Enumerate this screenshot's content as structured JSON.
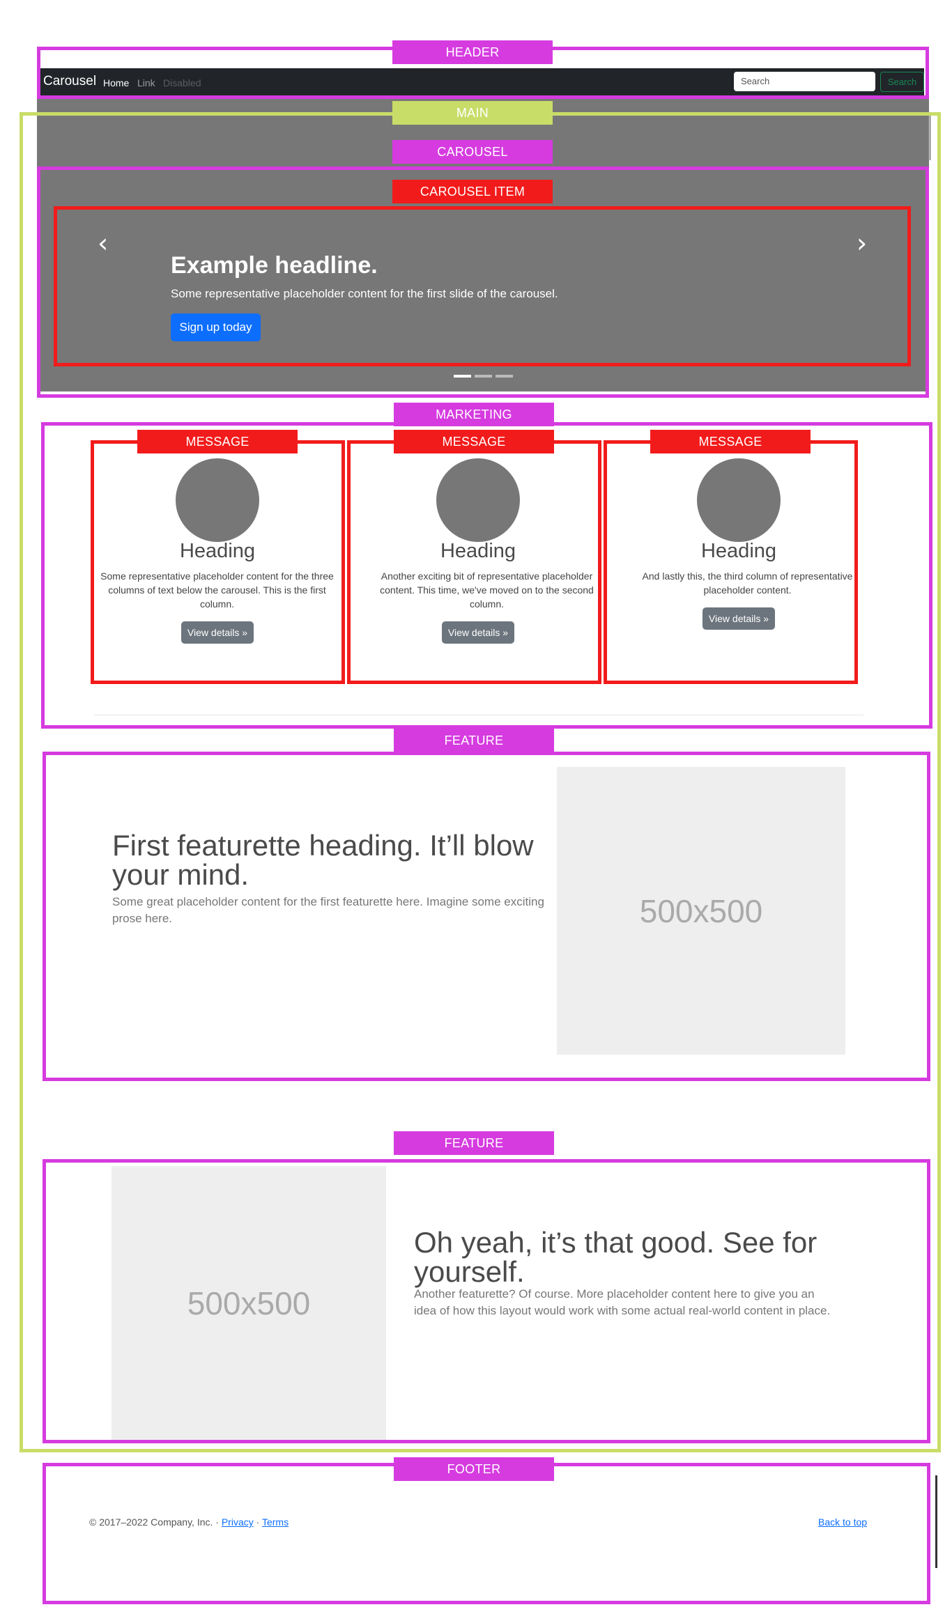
{
  "labels": {
    "header": "HEADER",
    "main": "MAIN",
    "carousel": "CAROUSEL",
    "carousel_item": "CAROUSEL ITEM",
    "marketing": "MARKETING",
    "message": "MESSAGE",
    "feature": "FEATURE",
    "footer": "FOOTER"
  },
  "navbar": {
    "brand": "Carousel",
    "links": [
      "Home",
      "Link",
      "Disabled"
    ],
    "search_placeholder": "Search",
    "search_button": "Search"
  },
  "carousel": {
    "headline": "Example headline.",
    "caption": "Some representative placeholder content for the first slide of the carousel.",
    "button": "Sign up today",
    "prev_glyph": "‹",
    "next_glyph": "›",
    "slide_count": 3,
    "active_slide": 1
  },
  "marketing": {
    "columns": [
      {
        "heading": "Heading",
        "text": "Some representative placeholder content for the three columns of text below the carousel. This is the first column.",
        "button": "View details »"
      },
      {
        "heading": "Heading",
        "text": "Another exciting bit of representative placeholder content. This time, we've moved on to the second column.",
        "button": "View details »"
      },
      {
        "heading": "Heading",
        "text": "And lastly this, the third column of representative placeholder content.",
        "button": "View details »"
      }
    ]
  },
  "features": [
    {
      "heading": "First featurette heading. It’ll blow your mind.",
      "text": "Some great placeholder content for the first featurette here. Imagine some exciting prose here.",
      "image_label": "500x500"
    },
    {
      "heading": "Oh yeah, it’s that good. See for yourself.",
      "text": "Another featurette? Of course. More placeholder content here to give you an idea of how this layout would work with some actual real-world content in place.",
      "image_label": "500x500"
    }
  ],
  "footer": {
    "copyright": "© 2017–2022 Company, Inc. · ",
    "privacy": "Privacy",
    "separator": " · ",
    "terms": "Terms",
    "back_to_top": "Back to top"
  },
  "colors": {
    "annotation_magenta": "#d63be0",
    "annotation_lime": "#c8dd68",
    "annotation_red": "#f21b1b",
    "navbar_bg": "#212529",
    "primary": "#0d6efd",
    "success": "#198754",
    "secondary": "#6c757d",
    "placeholder_gray": "#777777"
  }
}
